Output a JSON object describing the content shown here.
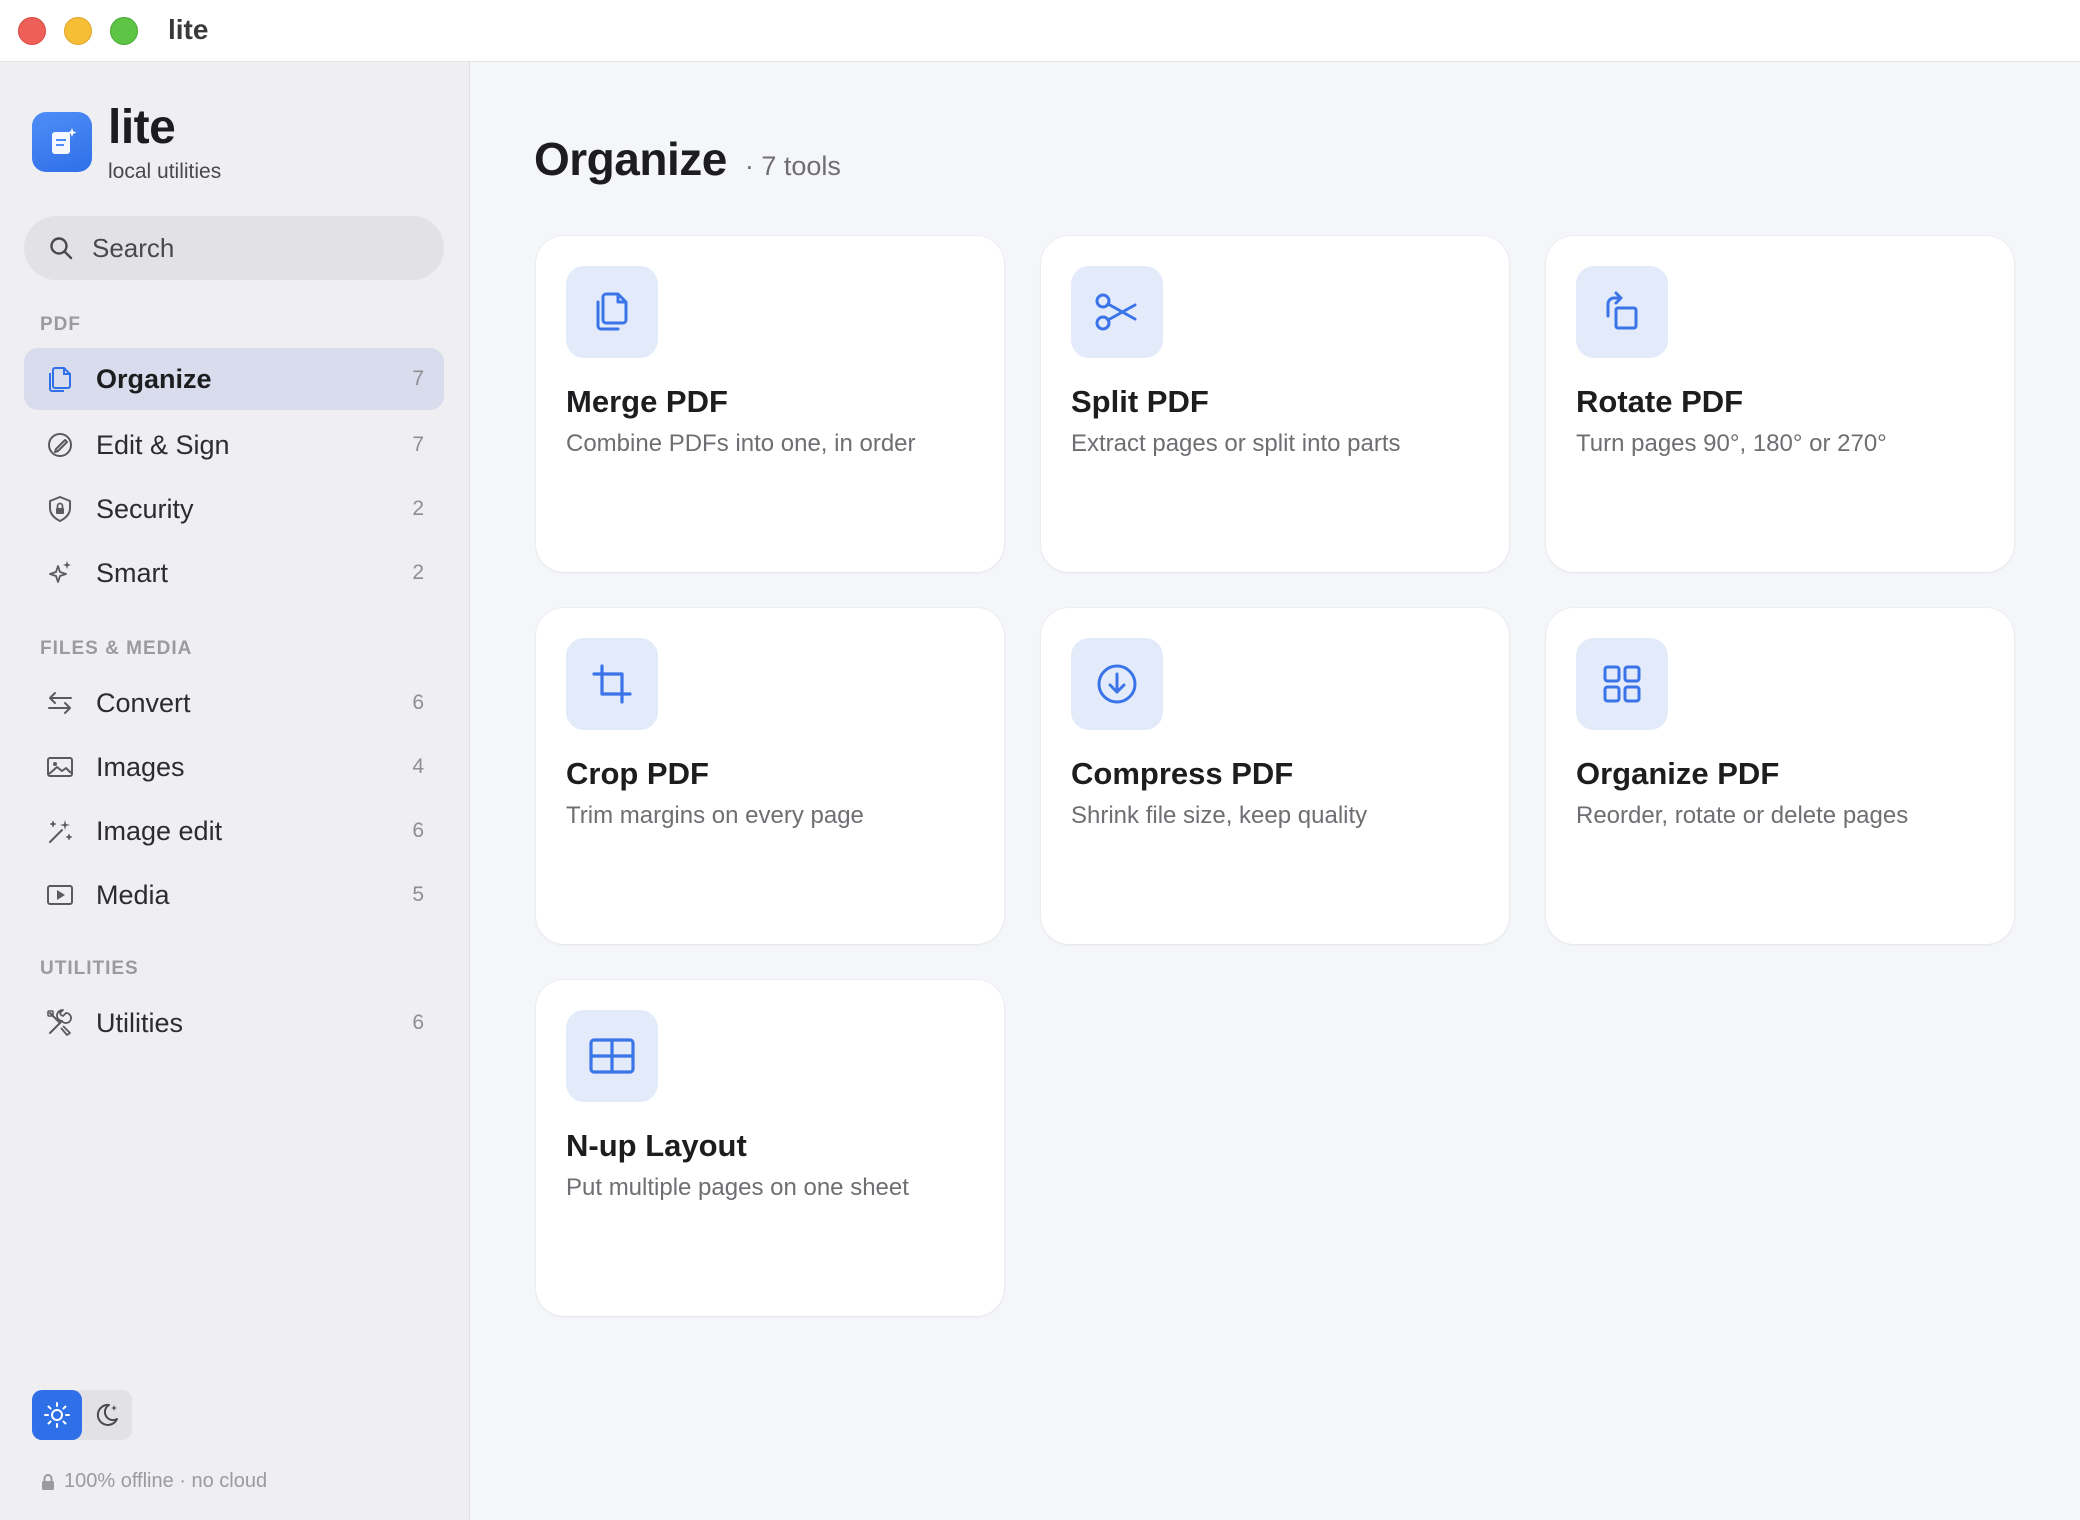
{
  "window": {
    "title": "lite"
  },
  "brand": {
    "name": "lite",
    "subtitle": "local utilities"
  },
  "search": {
    "placeholder": "Search"
  },
  "sidebar": {
    "sections": [
      {
        "label": "PDF"
      },
      {
        "label": "FILES & MEDIA"
      },
      {
        "label": "UTILITIES"
      }
    ],
    "items": [
      {
        "label": "Organize",
        "count": "7",
        "icon": "pages-icon",
        "active": true
      },
      {
        "label": "Edit & Sign",
        "count": "7",
        "icon": "pen-icon"
      },
      {
        "label": "Security",
        "count": "2",
        "icon": "shield-icon"
      },
      {
        "label": "Smart",
        "count": "2",
        "icon": "sparkle-icon"
      },
      {
        "label": "Convert",
        "count": "6",
        "icon": "arrows-icon"
      },
      {
        "label": "Images",
        "count": "4",
        "icon": "image-icon"
      },
      {
        "label": "Image edit",
        "count": "6",
        "icon": "magic-wand-icon"
      },
      {
        "label": "Media",
        "count": "5",
        "icon": "play-icon"
      },
      {
        "label": "Utilities",
        "count": "6",
        "icon": "tools-icon"
      }
    ]
  },
  "footer": {
    "offline_text": "100% offline · no cloud",
    "theme": "light"
  },
  "main": {
    "title": "Organize",
    "count_text": "· 7 tools",
    "cards": [
      {
        "title": "Merge PDF",
        "description": "Combine PDFs into one, in order",
        "icon": "merge-icon"
      },
      {
        "title": "Split PDF",
        "description": "Extract pages or split into parts",
        "icon": "scissors-icon"
      },
      {
        "title": "Rotate PDF",
        "description": "Turn pages 90°, 180° or 270°",
        "icon": "rotate-icon"
      },
      {
        "title": "Crop PDF",
        "description": "Trim margins on every page",
        "icon": "crop-icon"
      },
      {
        "title": "Compress PDF",
        "description": "Shrink file size, keep quality",
        "icon": "compress-icon"
      },
      {
        "title": "Organize PDF",
        "description": "Reorder, rotate or delete pages",
        "icon": "grid-icon"
      },
      {
        "title": "N-up Layout",
        "description": "Put multiple pages on one sheet",
        "icon": "layout-icon"
      }
    ]
  },
  "colors": {
    "accent": "#2f6fe8",
    "icon_tint": "#e3ebfb",
    "sidebar_active": "#d8dcec"
  }
}
